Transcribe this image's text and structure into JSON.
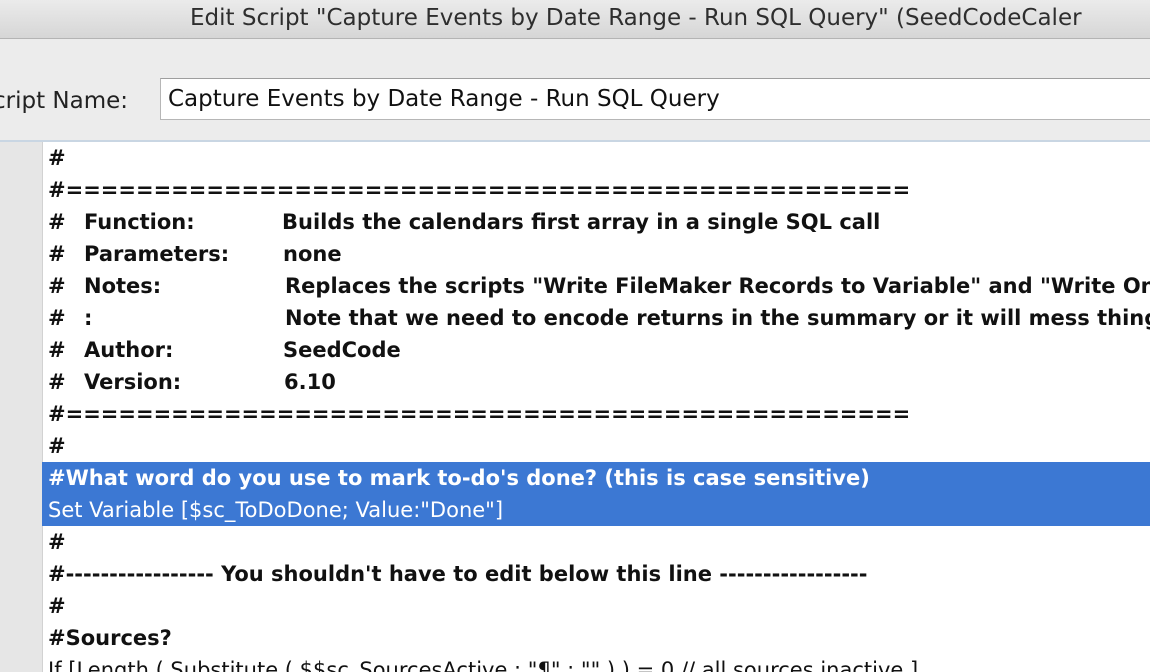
{
  "window": {
    "title": "Edit Script \"Capture Events by Date Range - Run SQL Query\" (SeedCodeCaler"
  },
  "script_name": {
    "label": "cript Name:",
    "value": "Capture Events by Date Range - Run SQL Query"
  },
  "script_steps": [
    {
      "text": "#"
    },
    {
      "text": "#================================================"
    },
    {
      "hash": "#",
      "key": "Function:",
      "value": "Builds the calendars first array in a single SQL call"
    },
    {
      "hash": "#",
      "key": "Parameters:",
      "value": "none"
    },
    {
      "hash": "#",
      "key": "Notes:",
      "value": "Replaces the scripts \"Write FileMaker Records to Variable\" and \"Write One Fi"
    },
    {
      "hash": "#",
      "key": ":",
      "value": "Note that we need to encode returns in the summary or it will mess things u"
    },
    {
      "hash": "#",
      "key": "Author:",
      "value": "SeedCode"
    },
    {
      "hash": "#",
      "key": "Version:",
      "value": "6.10"
    },
    {
      "text": "#================================================"
    },
    {
      "text": "#"
    },
    {
      "text": "#What word do you use to mark to-do's done? (this is case sensitive)"
    },
    {
      "text": "Set Variable [$sc_ToDoDone; Value:\"Done\"]"
    },
    {
      "text": "#"
    },
    {
      "text": "#-----------------  You shouldn't have to edit below this line  -----------------"
    },
    {
      "text": "#"
    },
    {
      "text": "#Sources?"
    },
    {
      "text": "If [Length ( Substitute ( $$sc_SourcesActive ; \"¶\" ; \"\" ) ) = 0 // all sources inactive ]"
    }
  ]
}
